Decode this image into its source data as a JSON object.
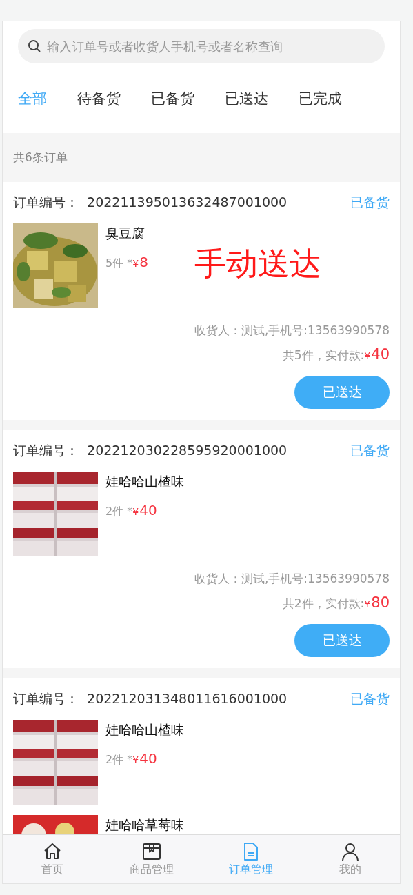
{
  "search": {
    "placeholder": "输入订单号或者收货人手机号或者名称查询"
  },
  "tabs": [
    {
      "label": "全部",
      "selected": true
    },
    {
      "label": "待备货",
      "selected": false
    },
    {
      "label": "已备货",
      "selected": false
    },
    {
      "label": "已送达",
      "selected": false
    },
    {
      "label": "已完成",
      "selected": false
    }
  ],
  "order_count": "共6条订单",
  "orders": [
    {
      "number_label": "订单编号：",
      "number": "202211395013632487001000",
      "status": "已备货",
      "items": [
        {
          "kind": "picture",
          "name": "臭豆腐",
          "qty": "5件 *",
          "currency": "¥",
          "price": "8"
        }
      ],
      "overlay": "手动送达",
      "receiver": "收货人：测试,手机号:13563990578",
      "total_label": "共5件，实付款:",
      "total_currency": "¥",
      "total": "40",
      "button": "已送达"
    },
    {
      "number_label": "订单编号：",
      "number": "202212030228595920001000",
      "status": "已备货",
      "items": [
        {
          "kind": "picture",
          "name": "娃哈哈山楂味",
          "qty": "2件 *",
          "currency": "¥",
          "price": "40"
        }
      ],
      "receiver": "收货人：测试,手机号:13563990578",
      "total_label": "共2件，实付款:",
      "total_currency": "¥",
      "total": "80",
      "button": "已送达"
    },
    {
      "number_label": "订单编号：",
      "number": "202212031348011616001000",
      "status": "已备货",
      "items": [
        {
          "kind": "picture",
          "name": "娃哈哈山楂味",
          "qty": "2件 *",
          "currency": "¥",
          "price": "40"
        },
        {
          "kind": "picture",
          "name": "娃哈哈草莓味"
        }
      ]
    }
  ],
  "bottom_nav": [
    {
      "label": "首页",
      "selected": false
    },
    {
      "label": "商品管理",
      "selected": false
    },
    {
      "label": "订单管理",
      "selected": true
    },
    {
      "label": "我的",
      "selected": false
    }
  ]
}
